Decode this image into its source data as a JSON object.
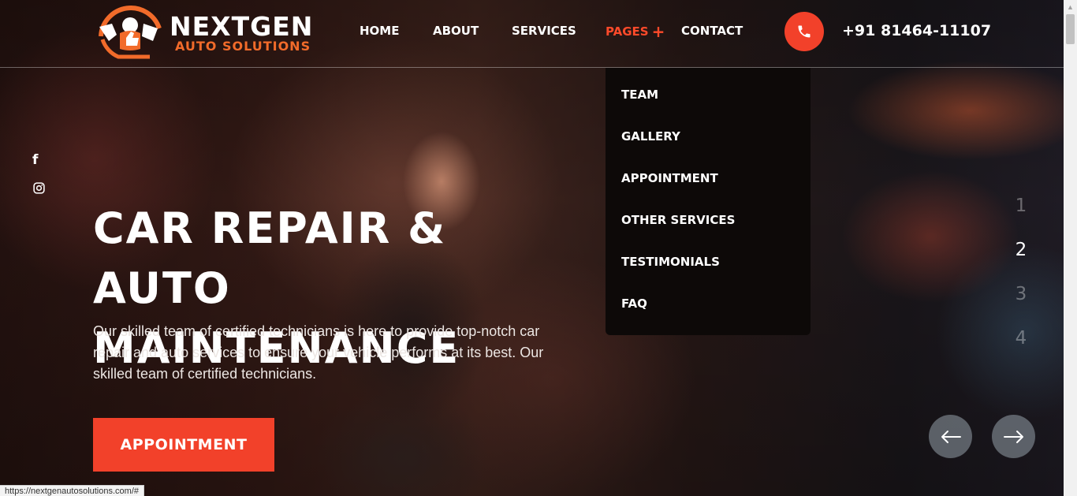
{
  "logo": {
    "title": "NEXTGEN",
    "subtitle": "AUTO SOLUTIONS",
    "icon": "mechanic-thumbs-up-icon",
    "accent_color": "#f26b2a"
  },
  "nav": {
    "items": [
      {
        "label": "HOME",
        "active": false
      },
      {
        "label": "ABOUT",
        "active": false
      },
      {
        "label": "SERVICES",
        "active": false
      },
      {
        "label": "PAGES",
        "active": true,
        "icon": "plus-icon",
        "icon_glyph": "+"
      },
      {
        "label": "CONTACT",
        "active": false
      }
    ],
    "active_color": "#ff4a2a"
  },
  "header": {
    "phone_icon": "phone-icon",
    "phone_number": "+91 81464-11107",
    "phone_button_color": "#f2412a"
  },
  "dropdown": {
    "items": [
      "TEAM",
      "GALLERY",
      "APPOINTMENT",
      "OTHER SERVICES",
      "TESTIMONIALS",
      "FAQ"
    ]
  },
  "social": {
    "glyphs": [
      "f",
      ""
    ],
    "icons": [
      "facebook-icon",
      "instagram-icon"
    ]
  },
  "hero": {
    "title_line1": "CAR REPAIR & AUTO",
    "title_line2": "MAINTENANCE",
    "description": "Our skilled team of certified technicians is here to provide top-notch car repair and auto services to ensure your vehicle performs at its best. Our skilled team of certified technicians.",
    "cta_label": "APPOINTMENT",
    "cta_color": "#f2412a"
  },
  "slider": {
    "pages": [
      "1",
      "2",
      "3",
      "4"
    ],
    "active_page": "2",
    "prev_icon": "arrow-left-icon",
    "next_icon": "arrow-right-icon"
  },
  "status_bar": {
    "url": "https://nextgenautosolutions.com/#"
  }
}
